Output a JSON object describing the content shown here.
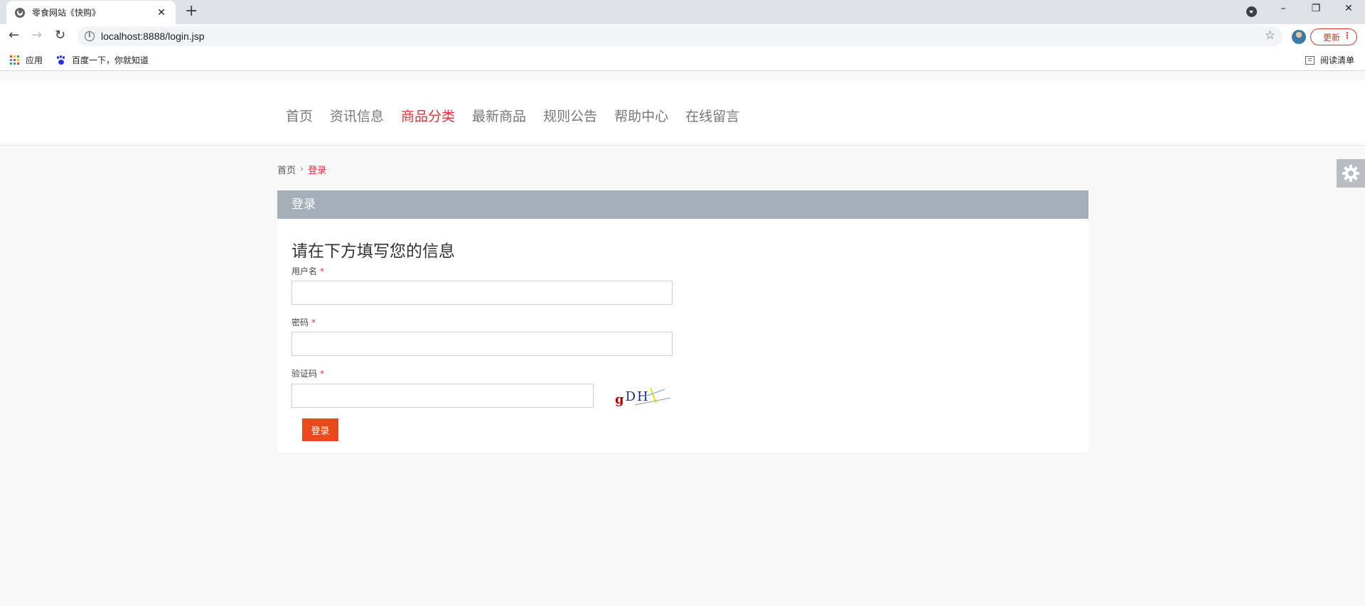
{
  "browser": {
    "tab_title": "零食网站《快购》",
    "tab_close": "✕",
    "new_tab": "+",
    "url": "localhost:8888/login.jsp",
    "update_label": "更新",
    "bookmarks": [
      {
        "label": "应用",
        "icon": "apps-icon"
      },
      {
        "label": "百度一下，你就知道",
        "icon": "baidu-paw-icon"
      }
    ],
    "reading_list": "阅读清单"
  },
  "nav": {
    "items": [
      "首页",
      "资讯信息",
      "商品分类",
      "最新商品",
      "规则公告",
      "帮助中心",
      "在线留言"
    ],
    "active_index": 2
  },
  "breadcrumb": {
    "home": "首页",
    "separator": "›",
    "current": "登录"
  },
  "panel": {
    "header": "登录",
    "title": "请在下方填写您的信息"
  },
  "form": {
    "username_label": "用户名",
    "password_label": "密码",
    "captcha_label": "验证码",
    "required_mark": "*",
    "captcha_text": "gDH",
    "submit_label": "登录"
  },
  "colors": {
    "accent_red": "#e0313a",
    "button_orange": "#e8491d",
    "panel_header": "#a6aeb8"
  }
}
